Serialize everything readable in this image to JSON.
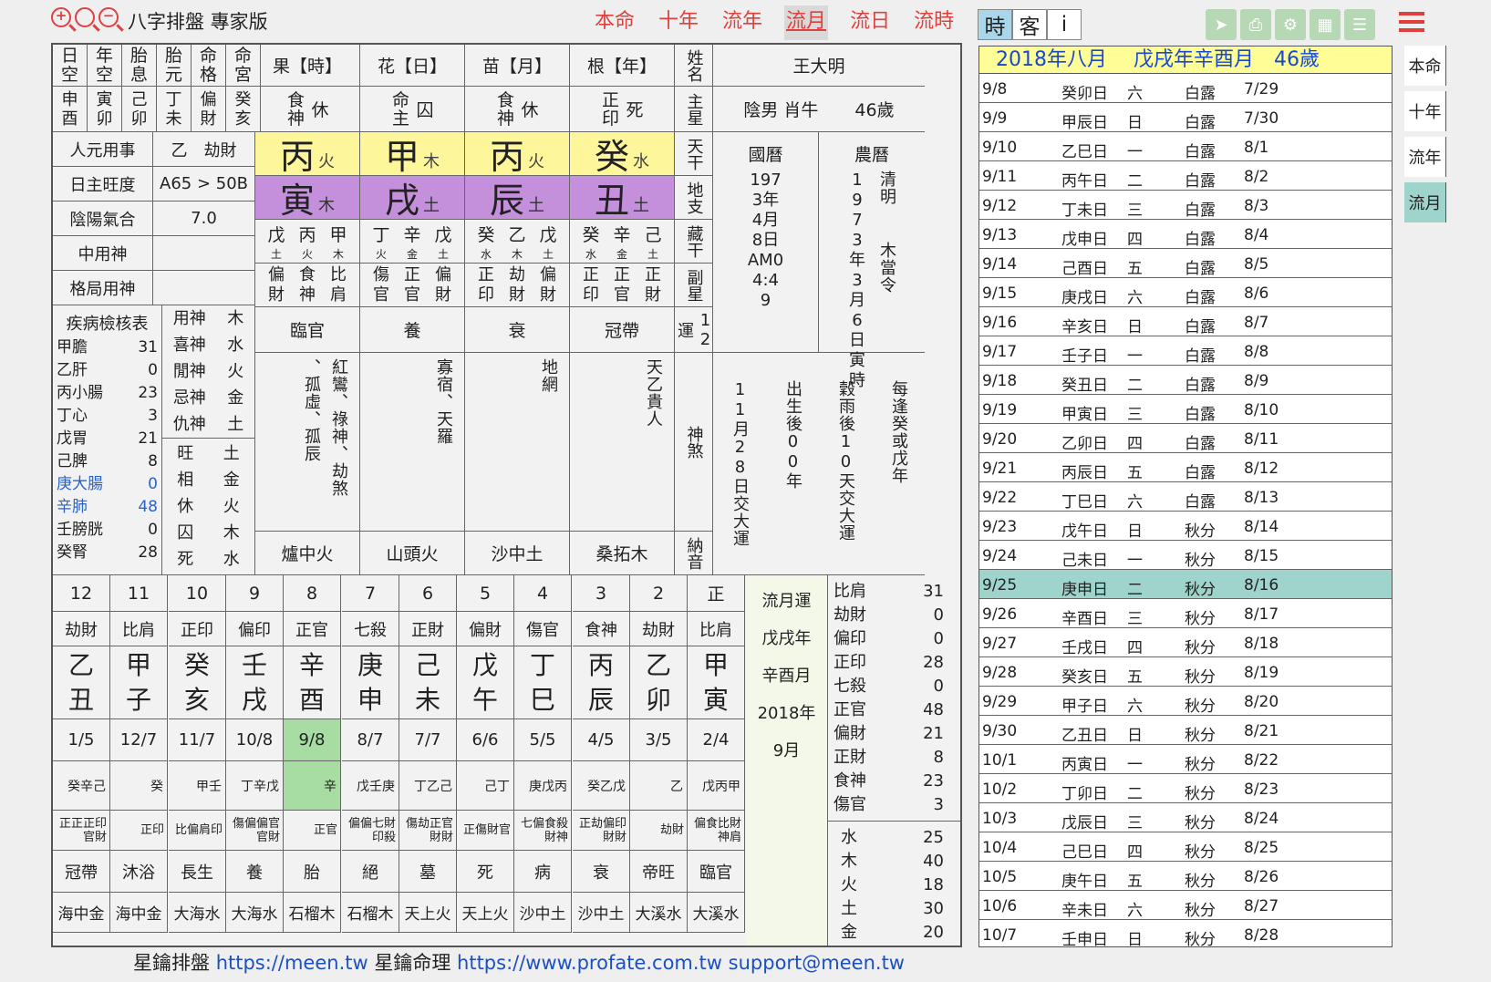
{
  "app": {
    "title": "八字排盤 專家版"
  },
  "nav": [
    {
      "label": "本命"
    },
    {
      "label": "十年"
    },
    {
      "label": "流年"
    },
    {
      "label": "流月"
    },
    {
      "label": "流日"
    },
    {
      "label": "流時"
    }
  ],
  "toggles": [
    {
      "label": "時"
    },
    {
      "label": "客"
    },
    {
      "label": "i"
    }
  ],
  "tool_icons": [
    "share-icon",
    "print-icon",
    "gear-icon",
    "calendar-icon",
    "chart-icon"
  ],
  "colors": {
    "accent": "#e0403c",
    "stem_bg": "#fdf69a",
    "branch_bg": "#c48fdb",
    "selected_row": "#9fd4cc"
  },
  "left_header": [
    "日空",
    "年空",
    "胎息",
    "胎元",
    "命格",
    "命宮"
  ],
  "left_values": [
    "申酉",
    "寅卯",
    "己卯",
    "丁未",
    "偏財",
    "癸亥"
  ],
  "pillar_headers": [
    "果【時】",
    "花【日】",
    "苗【月】",
    "根【年】"
  ],
  "gods": [
    {
      "a": "食神",
      "b": "休"
    },
    {
      "a": "命主",
      "b": "囚"
    },
    {
      "a": "食神",
      "b": "休"
    },
    {
      "a": "正印",
      "b": "死"
    }
  ],
  "stems": [
    {
      "ch": "丙",
      "el": "火"
    },
    {
      "ch": "甲",
      "el": "木"
    },
    {
      "ch": "丙",
      "el": "火"
    },
    {
      "ch": "癸",
      "el": "水"
    }
  ],
  "branches": [
    {
      "ch": "寅",
      "el": "木"
    },
    {
      "ch": "戌",
      "el": "土"
    },
    {
      "ch": "辰",
      "el": "土"
    },
    {
      "ch": "丑",
      "el": "土"
    }
  ],
  "hidden": [
    [
      "戊",
      "丙",
      "甲"
    ],
    [
      "丁",
      "辛",
      "戊"
    ],
    [
      "癸",
      "乙",
      "戊"
    ],
    [
      "癸",
      "辛",
      "己"
    ]
  ],
  "hidden_el": [
    [
      "土",
      "火",
      "木"
    ],
    [
      "火",
      "金",
      "土"
    ],
    [
      "水",
      "木",
      "土"
    ],
    [
      "水",
      "金",
      "土"
    ]
  ],
  "fuxing": [
    [
      "偏財",
      "食神",
      "比肩"
    ],
    [
      "傷官",
      "正官",
      "偏財"
    ],
    [
      "正印",
      "劫財",
      "偏財"
    ],
    [
      "正印",
      "正官",
      "正財"
    ]
  ],
  "yun12": [
    "臨官",
    "養",
    "衰",
    "冠帶"
  ],
  "shensha": [
    "紅鸞、祿神、劫煞",
    "、孤虛、孤辰",
    "寡宿、天羅",
    "地網",
    "天乙貴人"
  ],
  "nayin": [
    "爐中火",
    "山頭火",
    "沙中土",
    "桑拓木"
  ],
  "row_labels": {
    "name": "姓名",
    "main": "主星",
    "tg": "天干",
    "dz": "地支",
    "cg": "藏干",
    "fx": "副星",
    "yun": "12運",
    "ss": "神煞",
    "ny": "納音"
  },
  "person": {
    "name": "王大明",
    "desc": "陰男 肖牛",
    "age": "46歲"
  },
  "guoli": {
    "label": "國曆",
    "text": "1973年4月8日AM04:49"
  },
  "nongli": {
    "label": "農曆",
    "text": "1973年3月6日寅時",
    "side": "清明",
    "side2": "木當令"
  },
  "dayun_note": {
    "a": "出生後00年",
    "b": "11月28日交大運",
    "c": "每逢癸或戊年",
    "d": "穀雨後10天交大運"
  },
  "stats": [
    {
      "k": "人元用事",
      "v": "乙　劫財"
    },
    {
      "k": "日主旺度",
      "v": "A65 > 50B"
    },
    {
      "k": "陰陽氣合",
      "v": "7.0"
    },
    {
      "k": "中用神",
      "v": ""
    },
    {
      "k": "格局用神",
      "v": ""
    }
  ],
  "disease_title": "疾病檢核表",
  "disease": [
    {
      "k": "甲膽",
      "v": "31"
    },
    {
      "k": "乙肝",
      "v": "0"
    },
    {
      "k": "丙小腸",
      "v": "23"
    },
    {
      "k": "丁心",
      "v": "3"
    },
    {
      "k": "戊胃",
      "v": "21"
    },
    {
      "k": "己脾",
      "v": "8"
    },
    {
      "k": "庚大腸",
      "v": "0"
    },
    {
      "k": "辛肺",
      "v": "48"
    },
    {
      "k": "壬膀胱",
      "v": "0"
    },
    {
      "k": "癸腎",
      "v": "28"
    }
  ],
  "yongshen": [
    {
      "k": "用神",
      "v": "木"
    },
    {
      "k": "喜神",
      "v": "水"
    },
    {
      "k": "閒神",
      "v": "火"
    },
    {
      "k": "忌神",
      "v": "金"
    },
    {
      "k": "仇神",
      "v": "土"
    }
  ],
  "wangxiang": [
    {
      "k": "旺",
      "v": "土"
    },
    {
      "k": "相",
      "v": "金"
    },
    {
      "k": "休",
      "v": "火"
    },
    {
      "k": "囚",
      "v": "木"
    },
    {
      "k": "死",
      "v": "水"
    }
  ],
  "months": [
    {
      "n": "12",
      "god": "劫財",
      "s": "乙",
      "b": "丑",
      "d": "1/5",
      "h": "癸辛己",
      "f": "正正正印官財",
      "y": "冠帶",
      "ny": "海中金"
    },
    {
      "n": "11",
      "god": "比肩",
      "s": "甲",
      "b": "子",
      "d": "12/7",
      "h": "癸",
      "f": "正印",
      "y": "沐浴",
      "ny": "海中金"
    },
    {
      "n": "10",
      "god": "正印",
      "s": "癸",
      "b": "亥",
      "d": "11/7",
      "h": "甲壬",
      "f": "比偏肩印",
      "y": "長生",
      "ny": "大海水"
    },
    {
      "n": "9",
      "god": "偏印",
      "s": "壬",
      "b": "戌",
      "d": "10/8",
      "h": "丁辛戊",
      "f": "傷偏偏官官財",
      "y": "養",
      "ny": "大海水"
    },
    {
      "n": "8",
      "god": "正官",
      "s": "辛",
      "b": "酉",
      "d": "9/8",
      "h": "辛",
      "f": "正官",
      "y": "胎",
      "ny": "石榴木"
    },
    {
      "n": "7",
      "god": "七殺",
      "s": "庚",
      "b": "申",
      "d": "8/7",
      "h": "戊壬庚",
      "f": "偏偏七財印殺",
      "y": "絕",
      "ny": "石榴木"
    },
    {
      "n": "6",
      "god": "正財",
      "s": "己",
      "b": "未",
      "d": "7/7",
      "h": "丁乙己",
      "f": "傷劫正官財財",
      "y": "墓",
      "ny": "天上火"
    },
    {
      "n": "5",
      "god": "偏財",
      "s": "戊",
      "b": "午",
      "d": "6/6",
      "h": "己丁",
      "f": "正傷財官",
      "y": "死",
      "ny": "天上火"
    },
    {
      "n": "4",
      "god": "傷官",
      "s": "丁",
      "b": "巳",
      "d": "5/5",
      "h": "庚戊丙",
      "f": "七偏食殺財神",
      "y": "病",
      "ny": "沙中土"
    },
    {
      "n": "3",
      "god": "食神",
      "s": "丙",
      "b": "辰",
      "d": "4/5",
      "h": "癸乙戊",
      "f": "正劫偏印財財",
      "y": "衰",
      "ny": "沙中土"
    },
    {
      "n": "2",
      "god": "劫財",
      "s": "乙",
      "b": "卯",
      "d": "3/5",
      "h": "乙",
      "f": "劫財",
      "y": "帝旺",
      "ny": "大溪水"
    },
    {
      "n": "正",
      "god": "比肩",
      "s": "甲",
      "b": "寅",
      "d": "2/4",
      "h": "戊丙甲",
      "f": "偏食比財神肩",
      "y": "臨官",
      "ny": "大溪水"
    }
  ],
  "liuyue": {
    "title": "流月運",
    "y": "戊戌年",
    "m": "辛酉月",
    "yr": "2018年",
    "mo": "9月"
  },
  "tengods": [
    {
      "k": "比肩",
      "v": "31"
    },
    {
      "k": "劫財",
      "v": "0"
    },
    {
      "k": "偏印",
      "v": "0"
    },
    {
      "k": "正印",
      "v": "28"
    },
    {
      "k": "七殺",
      "v": "0"
    },
    {
      "k": "正官",
      "v": "48"
    },
    {
      "k": "偏財",
      "v": "21"
    },
    {
      "k": "正財",
      "v": "8"
    },
    {
      "k": "食神",
      "v": "23"
    },
    {
      "k": "傷官",
      "v": "3"
    }
  ],
  "elements": [
    {
      "k": "水",
      "v": "25"
    },
    {
      "k": "木",
      "v": "40"
    },
    {
      "k": "火",
      "v": "18"
    },
    {
      "k": "土",
      "v": "30"
    },
    {
      "k": "金",
      "v": "20"
    }
  ],
  "right_header": "2018年八月　 戊戌年辛酉月　46歲",
  "days": [
    [
      "9/8",
      "癸卯日",
      "六",
      "白露",
      "7/29"
    ],
    [
      "9/9",
      "甲辰日",
      "日",
      "白露",
      "7/30"
    ],
    [
      "9/10",
      "乙巳日",
      "一",
      "白露",
      "8/1"
    ],
    [
      "9/11",
      "丙午日",
      "二",
      "白露",
      "8/2"
    ],
    [
      "9/12",
      "丁未日",
      "三",
      "白露",
      "8/3"
    ],
    [
      "9/13",
      "戊申日",
      "四",
      "白露",
      "8/4"
    ],
    [
      "9/14",
      "己酉日",
      "五",
      "白露",
      "8/5"
    ],
    [
      "9/15",
      "庚戌日",
      "六",
      "白露",
      "8/6"
    ],
    [
      "9/16",
      "辛亥日",
      "日",
      "白露",
      "8/7"
    ],
    [
      "9/17",
      "壬子日",
      "一",
      "白露",
      "8/8"
    ],
    [
      "9/18",
      "癸丑日",
      "二",
      "白露",
      "8/9"
    ],
    [
      "9/19",
      "甲寅日",
      "三",
      "白露",
      "8/10"
    ],
    [
      "9/20",
      "乙卯日",
      "四",
      "白露",
      "8/11"
    ],
    [
      "9/21",
      "丙辰日",
      "五",
      "白露",
      "8/12"
    ],
    [
      "9/22",
      "丁巳日",
      "六",
      "白露",
      "8/13"
    ],
    [
      "9/23",
      "戊午日",
      "日",
      "秋分",
      "8/14"
    ],
    [
      "9/24",
      "己未日",
      "一",
      "秋分",
      "8/15"
    ],
    [
      "9/25",
      "庚申日",
      "二",
      "秋分",
      "8/16"
    ],
    [
      "9/26",
      "辛酉日",
      "三",
      "秋分",
      "8/17"
    ],
    [
      "9/27",
      "壬戌日",
      "四",
      "秋分",
      "8/18"
    ],
    [
      "9/28",
      "癸亥日",
      "五",
      "秋分",
      "8/19"
    ],
    [
      "9/29",
      "甲子日",
      "六",
      "秋分",
      "8/20"
    ],
    [
      "9/30",
      "乙丑日",
      "日",
      "秋分",
      "8/21"
    ],
    [
      "10/1",
      "丙寅日",
      "一",
      "秋分",
      "8/22"
    ],
    [
      "10/2",
      "丁卯日",
      "二",
      "秋分",
      "8/23"
    ],
    [
      "10/3",
      "戊辰日",
      "三",
      "秋分",
      "8/24"
    ],
    [
      "10/4",
      "己巳日",
      "四",
      "秋分",
      "8/25"
    ],
    [
      "10/5",
      "庚午日",
      "五",
      "秋分",
      "8/26"
    ],
    [
      "10/6",
      "辛未日",
      "六",
      "秋分",
      "8/27"
    ],
    [
      "10/7",
      "壬申日",
      "日",
      "秋分",
      "8/28"
    ]
  ],
  "selected_day": "9/25",
  "side_tabs": [
    {
      "label": "本命"
    },
    {
      "label": "十年"
    },
    {
      "label": "流年"
    },
    {
      "label": "流月"
    }
  ],
  "footer": {
    "a": "星鑰排盤",
    "url1": "https://meen.tw",
    "b": "星鑰命理",
    "url2": "https://www.profate.com.tw",
    "email": "support@meen.tw"
  }
}
